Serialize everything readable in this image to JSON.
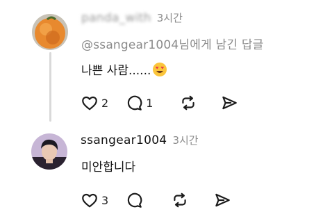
{
  "colors": {
    "thread_line": "#d9d9d9",
    "icon": "#1a1a1a",
    "muted": "#8c8c8c"
  },
  "comments": [
    {
      "username": "panda_with",
      "time": "3시간",
      "reply_to": "@ssangear1004님에게 남긴 답글",
      "text": "나쁜 사람......",
      "emoji": "heart-eyes-emoji",
      "likes": "2",
      "replies": "1"
    },
    {
      "username": "ssangear1004",
      "time": "3시간",
      "text": "미안합니다",
      "likes": "3",
      "replies": ""
    }
  ]
}
